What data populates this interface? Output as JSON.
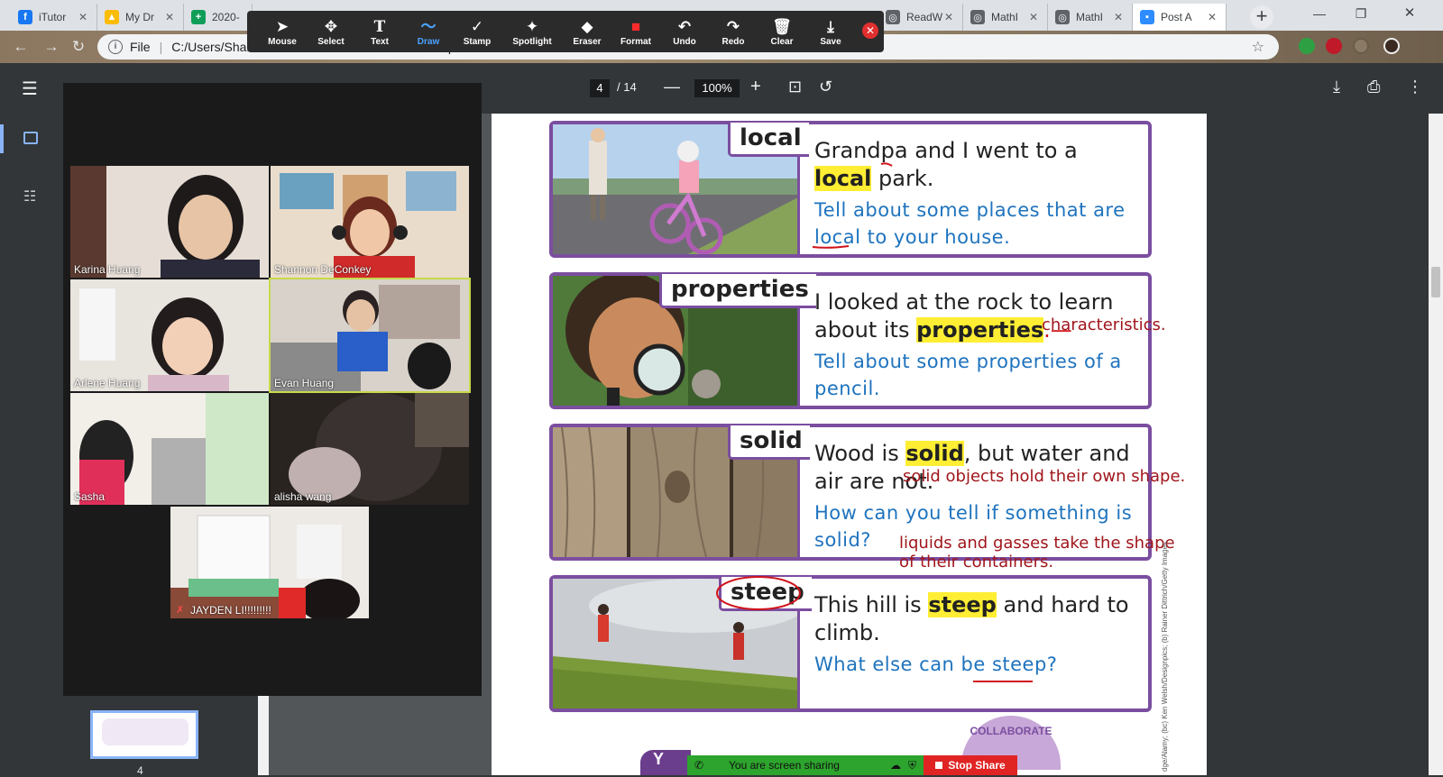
{
  "tabs": [
    {
      "title": "iTutor",
      "icon": "facebook-icon",
      "color": "#1877f2",
      "glyph": "f"
    },
    {
      "title": "My Dr",
      "icon": "google-drive-icon",
      "color": "#fbbc04",
      "glyph": "▲"
    },
    {
      "title": "2020-",
      "icon": "google-sheets-icon",
      "color": "#0f9d58",
      "glyph": "+"
    },
    {
      "title": "ReadW",
      "icon": "globe-icon",
      "color": "#5f6368",
      "glyph": "◎"
    },
    {
      "title": "MathI",
      "icon": "globe-icon",
      "color": "#5f6368",
      "glyph": "◎"
    },
    {
      "title": "MathI",
      "icon": "globe-icon",
      "color": "#5f6368",
      "glyph": "◎"
    },
    {
      "title": "Post A",
      "icon": "zoom-icon",
      "color": "#2d8cff",
      "glyph": "▪"
    }
  ],
  "address": {
    "label": "File",
    "url": "C:/Users/Shannon/Downloads/Lesson%20Slides.pdf"
  },
  "annotate": {
    "tools": [
      {
        "label": "Mouse",
        "icon": "mouse-pointer-icon",
        "glyph": "➤"
      },
      {
        "label": "Select",
        "icon": "move-icon",
        "glyph": "✥"
      },
      {
        "label": "Text",
        "icon": "text-icon",
        "glyph": "T"
      },
      {
        "label": "Draw",
        "icon": "draw-squiggle-icon",
        "glyph": "〜"
      },
      {
        "label": "Stamp",
        "icon": "stamp-check-icon",
        "glyph": "✓"
      },
      {
        "label": "Spotlight",
        "icon": "spotlight-wand-icon",
        "glyph": "✦"
      },
      {
        "label": "Eraser",
        "icon": "eraser-icon",
        "glyph": "◆"
      },
      {
        "label": "Format",
        "icon": "format-color-icon",
        "glyph": "■"
      },
      {
        "label": "Undo",
        "icon": "undo-icon",
        "glyph": "↶"
      },
      {
        "label": "Redo",
        "icon": "redo-icon",
        "glyph": "↷"
      },
      {
        "label": "Clear",
        "icon": "trash-icon",
        "glyph": "🗑"
      },
      {
        "label": "Save",
        "icon": "save-download-icon",
        "glyph": "⤓"
      }
    ],
    "active": "Draw"
  },
  "pdf": {
    "page": "4",
    "total": "/ 14",
    "zoom": "100%",
    "thumb_num": "4"
  },
  "cards": [
    {
      "word": "local",
      "sent_pre": "Grandpa and I went to a ",
      "sent_hl": "local",
      "sent_post": " park.",
      "question": "Tell about some places that are local to your house."
    },
    {
      "word": "properties",
      "sent_pre": "I looked at the rock to learn about its ",
      "sent_hl": "properties",
      "sent_post": ".—",
      "question": "Tell about some properties of a pencil."
    },
    {
      "word": "solid",
      "sent_pre": "Wood is ",
      "sent_hl": "solid",
      "sent_post": ", but water and air are not.",
      "question": "How can you tell if something is solid?"
    },
    {
      "word": "steep",
      "sent_pre": "This hill is ",
      "sent_hl": "steep",
      "sent_post": " and hard to climb.",
      "question": "What else can be steep?"
    }
  ],
  "notes": {
    "n1": "characteristics.",
    "n2": "solid objects hold their own shape.",
    "n3": "liquids and gasses take the shape",
    "n4": "of their containers."
  },
  "credit": "dge/Alamy; (bc) Ken Welsh/Designpics; (b) Rainer Dittrich/Getty Images",
  "badge": "COLLABORATE",
  "participants": [
    {
      "name": "Karina Huang"
    },
    {
      "name": "Shannon DeConkey"
    },
    {
      "name": "Arlene Huang"
    },
    {
      "name": "Evan Huang"
    },
    {
      "name": "Sasha"
    },
    {
      "name": "alisha wang"
    },
    {
      "name": "JAYDEN LI!!!!!!!!!"
    }
  ],
  "share": {
    "status": "You are screen sharing",
    "stop": "Stop Share",
    "logo": "Y"
  }
}
